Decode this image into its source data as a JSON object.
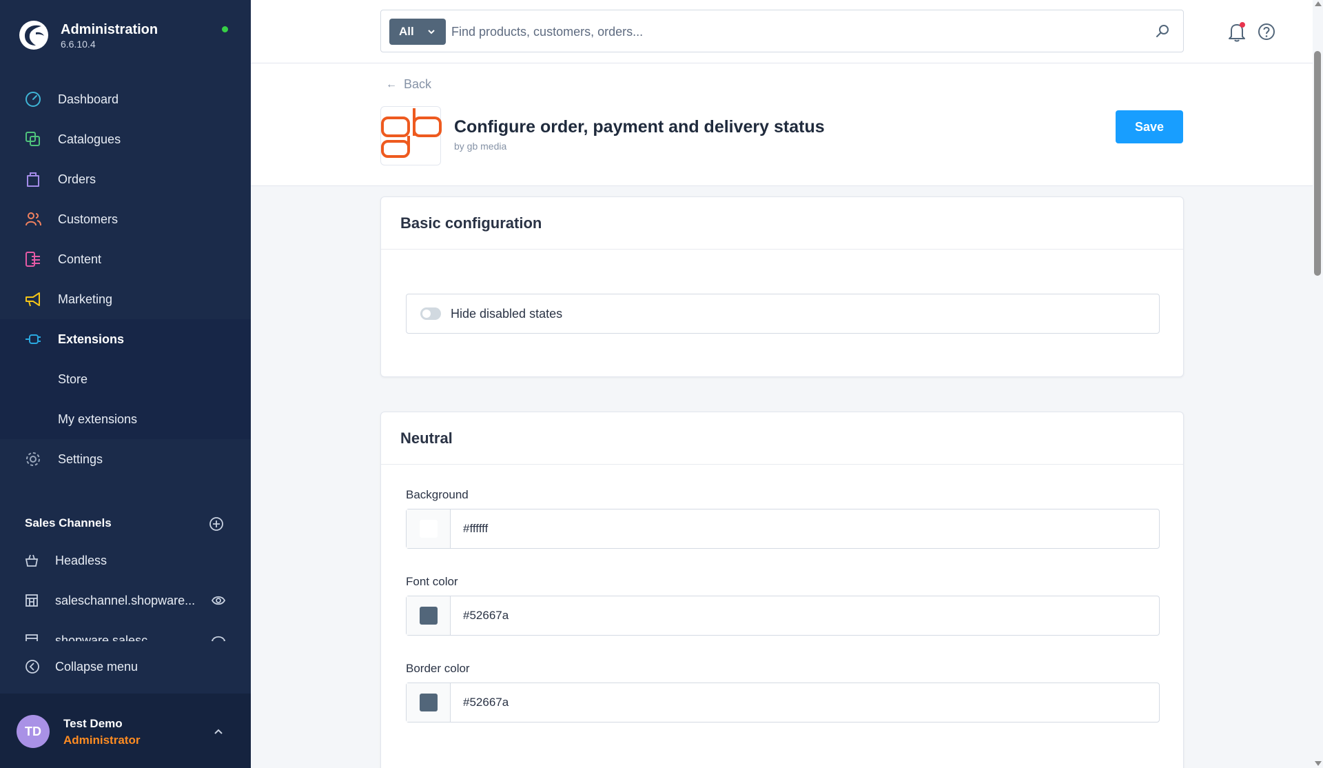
{
  "brand": {
    "title": "Administration",
    "version": "6.6.10.4"
  },
  "nav": {
    "items": [
      {
        "label": "Dashboard"
      },
      {
        "label": "Catalogues"
      },
      {
        "label": "Orders"
      },
      {
        "label": "Customers"
      },
      {
        "label": "Content"
      },
      {
        "label": "Marketing"
      },
      {
        "label": "Extensions"
      },
      {
        "label": "Settings"
      }
    ],
    "extensions_sub": [
      {
        "label": "Store"
      },
      {
        "label": "My extensions"
      }
    ]
  },
  "sales_channels": {
    "title": "Sales Channels",
    "items": [
      {
        "label": "Headless"
      },
      {
        "label": "saleschannel.shopware..."
      },
      {
        "label": "shopware.salesc..."
      }
    ]
  },
  "collapse_label": "Collapse menu",
  "user": {
    "initials": "TD",
    "name": "Test Demo",
    "role": "Administrator"
  },
  "search": {
    "type_label": "All",
    "placeholder": "Find products, customers, orders..."
  },
  "page": {
    "back_label": "Back",
    "title": "Configure order, payment and delivery status",
    "author": "by gb media",
    "save_label": "Save"
  },
  "basic_config": {
    "title": "Basic configuration",
    "toggle_label": "Hide disabled states"
  },
  "neutral": {
    "title": "Neutral",
    "fields": [
      {
        "label": "Background",
        "value": "#ffffff"
      },
      {
        "label": "Font color",
        "value": "#52667a"
      },
      {
        "label": "Border color",
        "value": "#52667a"
      }
    ]
  },
  "colors": {
    "sidebar_bg": "#1b2b4a",
    "primary": "#189eff",
    "role_accent": "#ff8c22",
    "status_online": "#37d046",
    "swatch_white": "#ffffff",
    "swatch_dark": "#52667a"
  }
}
